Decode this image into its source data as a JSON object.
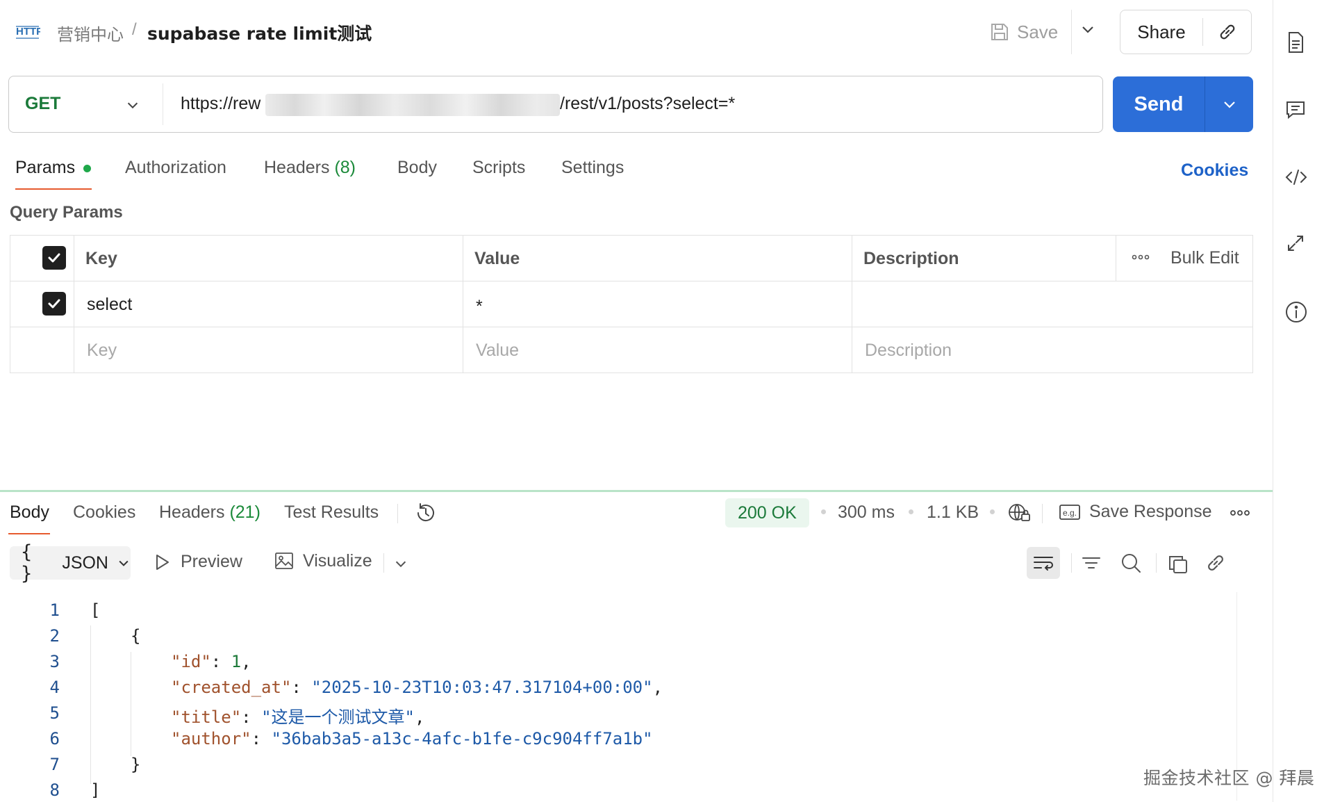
{
  "header": {
    "breadcrumb_parent": "营销中心",
    "breadcrumb_separator": "/",
    "request_title": "supabase rate limit测试",
    "save_label": "Save",
    "share_label": "Share"
  },
  "request": {
    "method": "GET",
    "method_color": "#1b7a3a",
    "url_prefix": "https://rew",
    "url_suffix": "/rest/v1/posts?select=*",
    "send_label": "Send",
    "accent_color": "#2c6ed8"
  },
  "request_tabs": {
    "params": "Params",
    "authorization": "Authorization",
    "headers": "Headers",
    "headers_count": "(8)",
    "body": "Body",
    "scripts": "Scripts",
    "settings": "Settings",
    "cookies": "Cookies"
  },
  "query_params": {
    "title": "Query Params",
    "columns": {
      "key": "Key",
      "value": "Value",
      "description": "Description"
    },
    "bulk_edit": "Bulk Edit",
    "rows": [
      {
        "checked": true,
        "key": "select",
        "value": "*",
        "description": ""
      }
    ],
    "placeholder": {
      "key": "Key",
      "value": "Value",
      "description": "Description"
    }
  },
  "response": {
    "tabs": {
      "body": "Body",
      "cookies": "Cookies",
      "headers": "Headers",
      "headers_count": "(21)",
      "test_results": "Test Results"
    },
    "status": "200 OK",
    "time": "300 ms",
    "size": "1.1 KB",
    "save_response": "Save Response",
    "format": "JSON",
    "format_braces": "{ }",
    "preview": "Preview",
    "visualize": "Visualize"
  },
  "code": {
    "line_numbers": [
      "1",
      "2",
      "3",
      "4",
      "5",
      "6",
      "7",
      "8"
    ],
    "open_bracket": "[",
    "open_brace": "{",
    "k_id": "\"id\"",
    "v_id": "1",
    "k_created_at": "\"created_at\"",
    "v_created_at": "\"2025-10-23T10:03:47.317104+00:00\"",
    "k_title": "\"title\"",
    "v_title": "\"这是一个测试文章\"",
    "k_author": "\"author\"",
    "v_author": "\"36bab3a5-a13c-4afc-b1fe-c9c904ff7a1b\"",
    "close_brace": "}",
    "close_bracket": "]"
  },
  "watermark": "掘金技术社区 @ 拜晨",
  "icons": [
    "http-icon",
    "save-icon",
    "chevron-down-icon",
    "link-icon",
    "document-icon",
    "comment-icon",
    "code-icon",
    "resize-icon",
    "info-icon",
    "history-icon",
    "globe-lock-icon",
    "example-icon",
    "more-icon",
    "play-icon",
    "image-icon",
    "wrap-lines-icon",
    "filter-icon",
    "search-icon",
    "copy-icon",
    "checkbox-checked-icon"
  ]
}
